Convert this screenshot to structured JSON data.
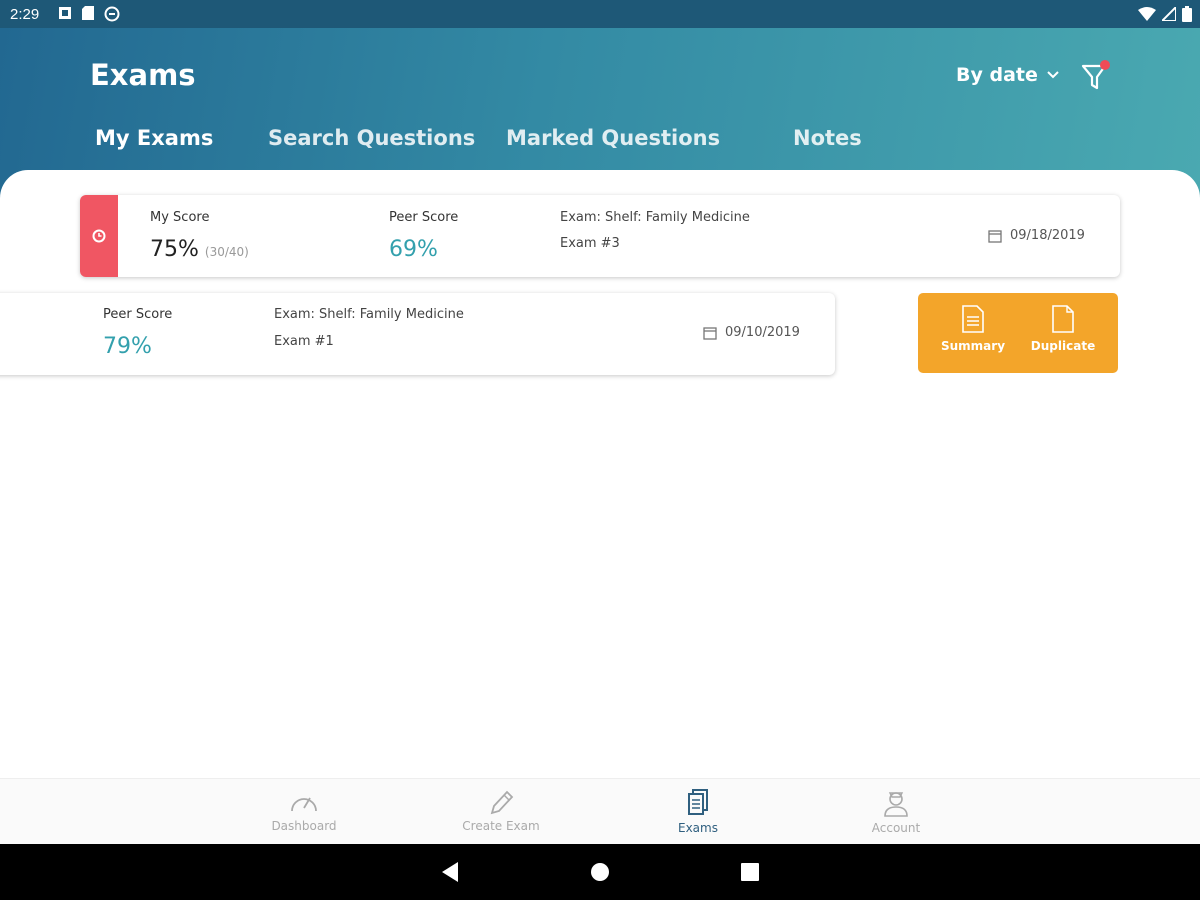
{
  "status_bar": {
    "time": "2:29"
  },
  "header": {
    "title": "Exams",
    "sort_label": "By date",
    "tabs": [
      {
        "label": "My Exams",
        "active": true
      },
      {
        "label": "Search Questions",
        "active": false
      },
      {
        "label": "Marked Questions",
        "active": false
      },
      {
        "label": "Notes",
        "active": false
      }
    ]
  },
  "exams": [
    {
      "my_score_label": "My Score",
      "my_score": "75%",
      "my_score_detail": "(30/40)",
      "peer_score_label": "Peer Score",
      "peer_score": "69%",
      "exam_name": "Exam: Shelf: Family Medicine",
      "exam_number": "Exam #3",
      "date": "09/18/2019"
    },
    {
      "peer_score_label": "Peer Score",
      "peer_score": "79%",
      "exam_name": "Exam: Shelf: Family Medicine",
      "exam_number": "Exam #1",
      "date": "09/10/2019"
    }
  ],
  "swipe_actions": {
    "summary": "Summary",
    "duplicate": "Duplicate"
  },
  "bottom_nav": [
    {
      "label": "Dashboard",
      "icon": "speedometer-icon",
      "active": false
    },
    {
      "label": "Create Exam",
      "icon": "pencil-icon",
      "active": false
    },
    {
      "label": "Exams",
      "icon": "documents-icon",
      "active": true
    },
    {
      "label": "Account",
      "icon": "user-icon",
      "active": false
    }
  ],
  "colors": {
    "header_start": "#226891",
    "header_end": "#4aa9b1",
    "score_teal": "#33a0ad",
    "stripe_red": "#f05663",
    "action_orange": "#f3a52a",
    "active_nav": "#2f5f7f"
  }
}
